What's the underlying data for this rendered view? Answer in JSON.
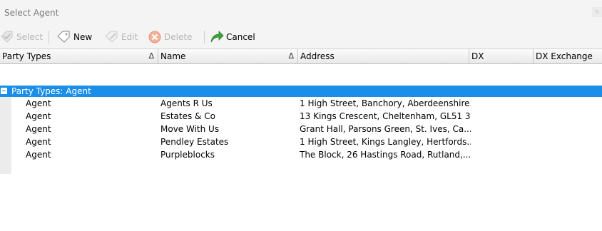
{
  "window": {
    "title": "Select Agent",
    "close_glyph": "×"
  },
  "toolbar": {
    "buttons": [
      {
        "label": "Select",
        "icon": "select-icon",
        "enabled": false
      },
      {
        "label": "New",
        "icon": "new-icon",
        "enabled": true
      },
      {
        "label": "Edit",
        "icon": "edit-icon",
        "enabled": false
      },
      {
        "label": "Delete",
        "icon": "delete-icon",
        "enabled": false
      },
      {
        "label": "Cancel",
        "icon": "cancel-icon",
        "enabled": true
      }
    ]
  },
  "grid": {
    "columns": [
      {
        "label": "Party Types",
        "sort": "Δ"
      },
      {
        "label": "Name",
        "sort": "Δ"
      },
      {
        "label": "Address",
        "sort": ""
      },
      {
        "label": "DX",
        "sort": ""
      },
      {
        "label": "DX Exchange",
        "sort": ""
      }
    ],
    "group": {
      "label": "Party Types: Agent"
    },
    "rows": [
      {
        "party_type": "Agent",
        "name": "Agents R Us",
        "address": "1 High Street, Banchory, Aberdeenshire...",
        "dx": "",
        "dx_exchange": ""
      },
      {
        "party_type": "Agent",
        "name": "Estates & Co",
        "address": "13 Kings Crescent, Cheltenham, GL51 3...",
        "dx": "",
        "dx_exchange": ""
      },
      {
        "party_type": "Agent",
        "name": "Move With Us",
        "address": "Grant Hall, Parsons Green, St. Ives, Ca...",
        "dx": "",
        "dx_exchange": ""
      },
      {
        "party_type": "Agent",
        "name": "Pendley Estates",
        "address": "1 High Street, Kings Langley, Hertfords...",
        "dx": "",
        "dx_exchange": ""
      },
      {
        "party_type": "Agent",
        "name": "Purpleblocks",
        "address": "The Block, 26 Hastings Road, Rutland,...",
        "dx": "",
        "dx_exchange": ""
      }
    ]
  },
  "colors": {
    "group_row_bg": "#1a8ee8",
    "chrome_bg": "#f4f4f4",
    "disabled_text": "#b7b7b7"
  }
}
